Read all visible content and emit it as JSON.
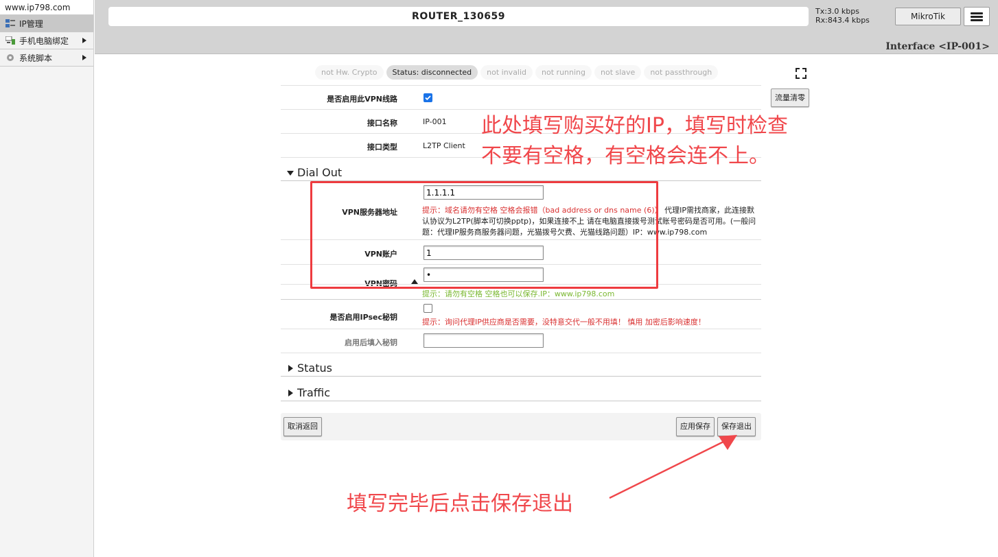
{
  "sidebar": {
    "site_url": "www.ip798.com",
    "items": [
      {
        "label": "IP管理",
        "icon": "ip-manage-icon"
      },
      {
        "label": "手机电脑绑定",
        "icon": "device-bind-icon"
      },
      {
        "label": "系统脚本",
        "icon": "gear-icon"
      }
    ]
  },
  "header": {
    "router_name": "ROUTER_130659",
    "tx": "Tx:3.0 kbps",
    "rx": "Rx:843.4 kbps",
    "brand_button": "MikroTik",
    "page_title": "Interface <IP-001>"
  },
  "status_pills": [
    {
      "label": "not Hw. Crypto",
      "active": false
    },
    {
      "label": "Status: disconnected",
      "active": true
    },
    {
      "label": "not invalid",
      "active": false
    },
    {
      "label": "not running",
      "active": false
    },
    {
      "label": "not slave",
      "active": false
    },
    {
      "label": "not passthrough",
      "active": false
    }
  ],
  "reset_traffic_label": "流量清零",
  "form": {
    "enable_vpn_label": "是否启用此VPN线路",
    "enable_vpn_checked": true,
    "if_name_label": "接口名称",
    "if_name_value": "IP-001",
    "if_type_label": "接口类型",
    "if_type_value": "L2TP Client",
    "dial_out_section": "Dial Out",
    "server_label": "VPN服务器地址",
    "server_value": "1.1.1.1",
    "server_hint_red": "提示：域名请勿有空格 空格会报错（bad address or dns name (6)）",
    "server_hint_line1_dark": "代理IP需找商家，此连接默",
    "server_hint_line2": "认协议为L2TP(脚本可切换pptp)，如果连接不上 请在电脑直接拨号测试账号密码是否可用。(一般问",
    "server_hint_line3": "题：代理IP服务商服务器问题，光猫拨号欠费、光猫线路问题）IP：www.ip798.com",
    "account_label": "VPN账户",
    "account_value": "1",
    "password_label": "VPN密码",
    "password_value": "•",
    "password_hint": "提示：请勿有空格 空格也可以保存.IP：www.ip798.com",
    "ipsec_label": "是否启用IPsec秘钥",
    "ipsec_checked": false,
    "ipsec_hint": "提示：询问代理IP供应商是否需要，没特意交代一般不用填！  慎用 加密后影响速度！",
    "secret_label": "启用后填入秘钥",
    "secret_value": "",
    "status_section": "Status",
    "traffic_section": "Traffic"
  },
  "footer": {
    "cancel_label": "取消返回",
    "apply_label": "应用保存",
    "save_exit_label": "保存退出"
  },
  "annotations": {
    "ip_note_line1": "此处填写购买好的IP，填写时检查",
    "ip_note_line2": "不要有空格，有空格会连不上。",
    "save_note": "填写完毕后点击保存退出",
    "color": "#f0474b"
  }
}
